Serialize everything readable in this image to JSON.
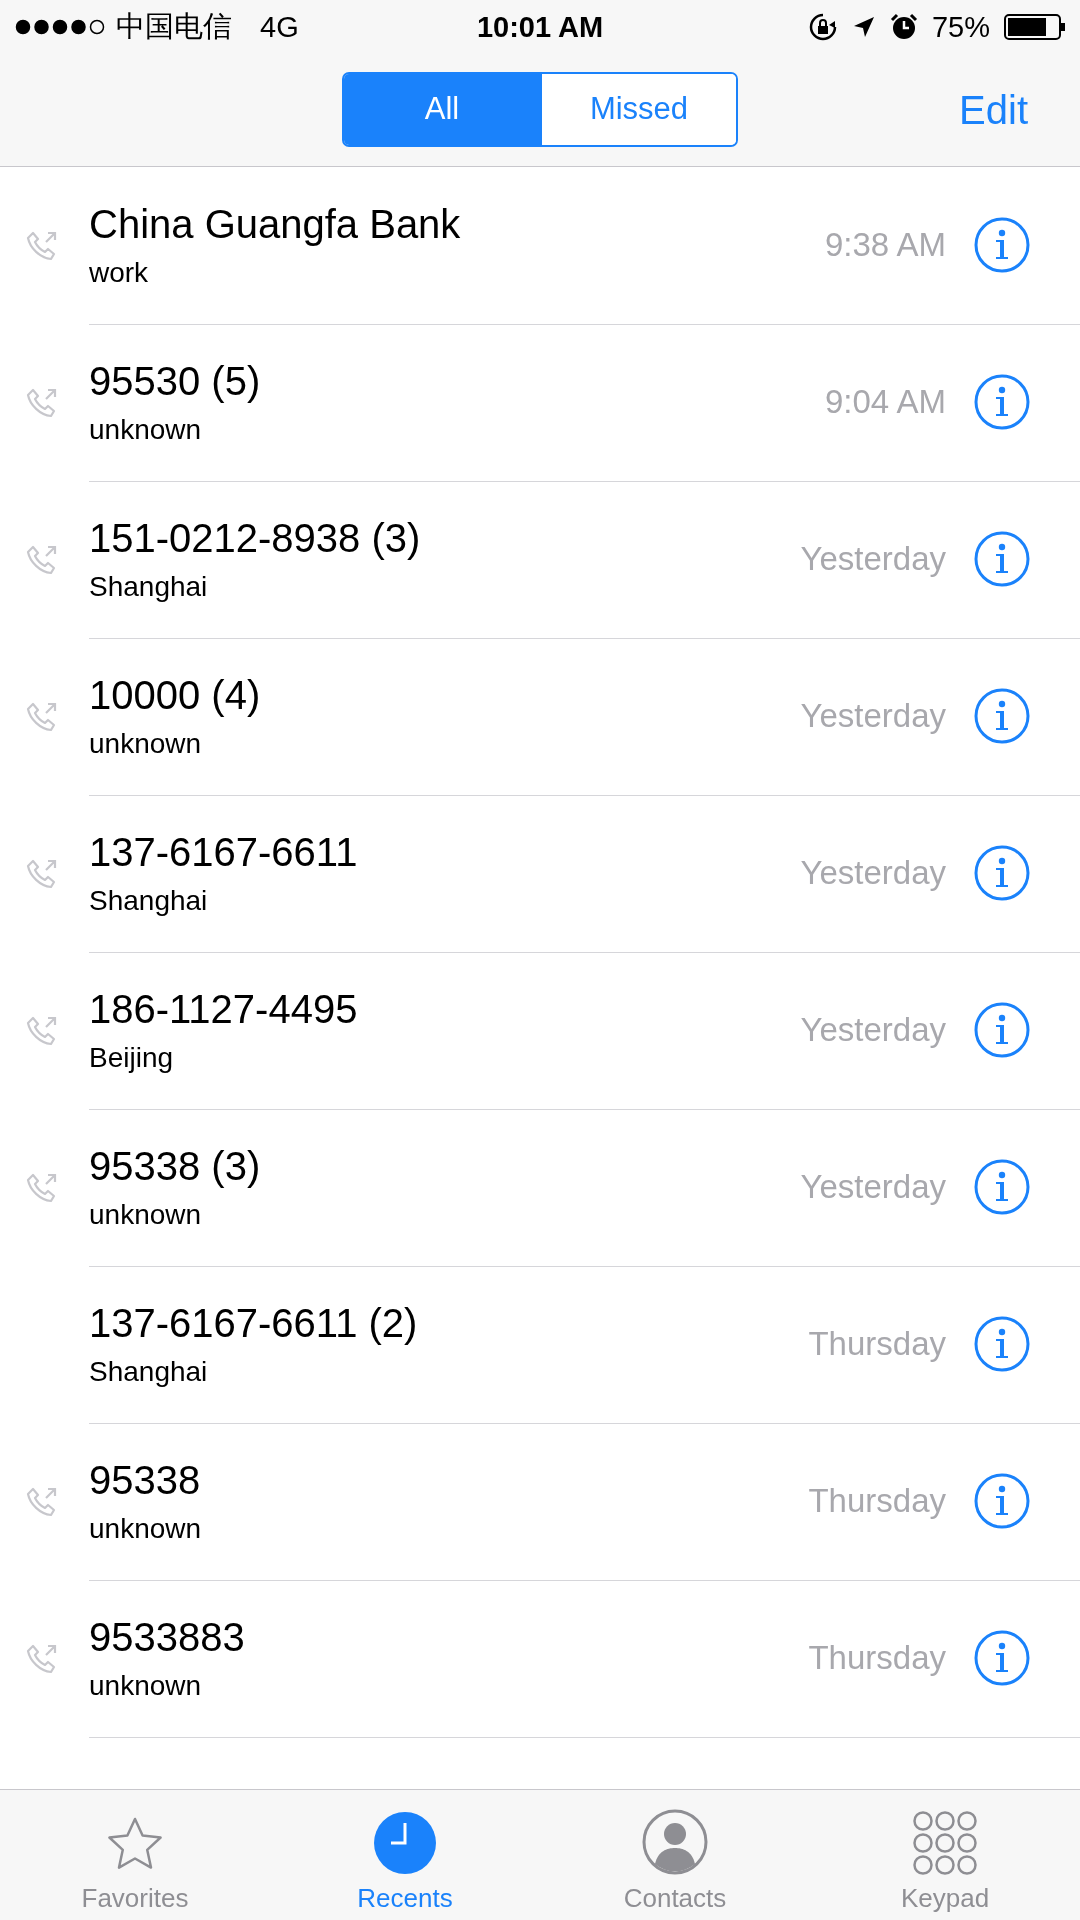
{
  "status_bar": {
    "signal_carrier": "中国电信",
    "network": "4G",
    "time": "10:01 AM",
    "battery": "75%"
  },
  "nav": {
    "segments": [
      {
        "label": "All",
        "selected": true
      },
      {
        "label": "Missed",
        "selected": false
      }
    ],
    "edit": "Edit"
  },
  "calls": [
    {
      "name": "China Guangfa Bank",
      "detail": "work",
      "time": "9:38 AM",
      "outgoing": true
    },
    {
      "name": "95530 (5)",
      "detail": "unknown",
      "time": "9:04 AM",
      "outgoing": true
    },
    {
      "name": "151-0212-8938 (3)",
      "detail": "Shanghai",
      "time": "Yesterday",
      "outgoing": true
    },
    {
      "name": "10000 (4)",
      "detail": "unknown",
      "time": "Yesterday",
      "outgoing": true
    },
    {
      "name": "137-6167-6611",
      "detail": "Shanghai",
      "time": "Yesterday",
      "outgoing": true
    },
    {
      "name": "186-1127-4495",
      "detail": "Beijing",
      "time": "Yesterday",
      "outgoing": true
    },
    {
      "name": "95338 (3)",
      "detail": "unknown",
      "time": "Yesterday",
      "outgoing": true
    },
    {
      "name": "137-6167-6611 (2)",
      "detail": "Shanghai",
      "time": "Thursday",
      "outgoing": false
    },
    {
      "name": "95338",
      "detail": "unknown",
      "time": "Thursday",
      "outgoing": true
    },
    {
      "name": "9533883",
      "detail": "unknown",
      "time": "Thursday",
      "outgoing": true
    }
  ],
  "tab_bar": [
    {
      "label": "Favorites",
      "selected": false
    },
    {
      "label": "Recents",
      "selected": true
    },
    {
      "label": "Contacts",
      "selected": false
    },
    {
      "label": "Keypad",
      "selected": false
    }
  ]
}
